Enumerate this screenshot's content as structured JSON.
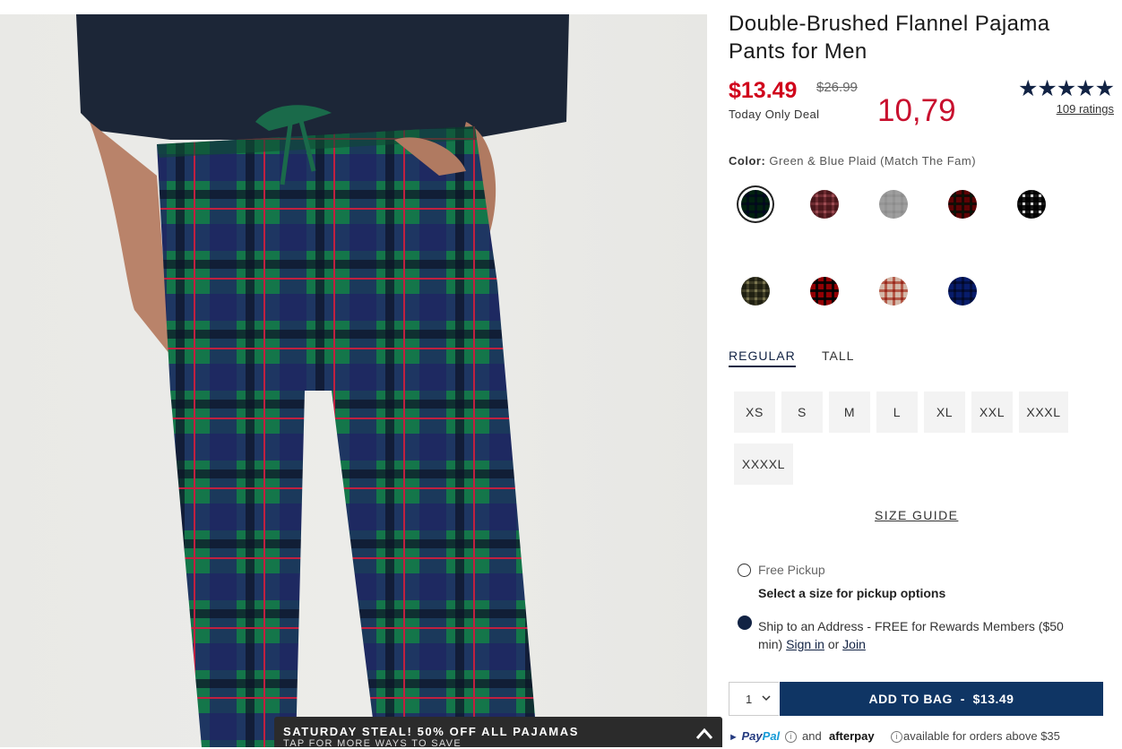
{
  "promo": {
    "title": "SATURDAY STEAL! 50% OFF ALL PAJAMAS",
    "subtitle": "TAP FOR MORE WAYS TO SAVE"
  },
  "product": {
    "title": "Double-Brushed Flannel Pajama Pants for Men",
    "price_now": "$13.49",
    "price_was": "$26.99",
    "deal_label": "Today Only Deal",
    "alt_price": "10,79",
    "stars": "★★★★★",
    "rating_count": 5,
    "ratings_label": "109 ratings",
    "color_label": "Color:",
    "color_value": "Green & Blue Plaid (Match The Fam)"
  },
  "swatches": [
    {
      "name": "green-blue-plaid",
      "colors": [
        "#0c5a40",
        "#1d2a5c"
      ],
      "selected": true
    },
    {
      "name": "mauve-plaid",
      "colors": [
        "#8a4f55",
        "#c98c92"
      ],
      "selected": false
    },
    {
      "name": "heather-gray",
      "colors": [
        "#c9c9c9",
        "#bdbdbd"
      ],
      "selected": false
    },
    {
      "name": "red-tartan",
      "colors": [
        "#9a1c1f",
        "#2b4a2a"
      ],
      "selected": false
    },
    {
      "name": "black-white-buffalo",
      "colors": [
        "#1a1a1a",
        "#e8e8e8"
      ],
      "selected": false
    },
    {
      "name": "olive-plaid",
      "colors": [
        "#5b5a44",
        "#b0ad8e"
      ],
      "selected": false
    },
    {
      "name": "red-black-buffalo",
      "colors": [
        "#c1121f",
        "#1a1a1a"
      ],
      "selected": false
    },
    {
      "name": "cream-red-plaid",
      "colors": [
        "#e8d8cf",
        "#c66a5a"
      ],
      "selected": false
    },
    {
      "name": "blue-buffalo",
      "colors": [
        "#2c55a5",
        "#1a2f63"
      ],
      "selected": false
    }
  ],
  "fit_tabs": [
    {
      "label": "REGULAR",
      "active": true
    },
    {
      "label": "TALL",
      "active": false
    }
  ],
  "sizes": [
    "XS",
    "S",
    "M",
    "L",
    "XL",
    "XXL",
    "XXXL",
    "XXXXL"
  ],
  "size_guide": "SIZE GUIDE",
  "fulfillment": {
    "pickup_label": "Free Pickup",
    "pickup_note": "Select a size for pickup options",
    "ship_text": "Ship to an Address - FREE for Rewards Members ($50",
    "ship_text2": "min)",
    "sign_in": "Sign in",
    "or": "or",
    "join": "Join"
  },
  "cart": {
    "quantity": "1",
    "add_label": "ADD TO BAG  -  $13.49"
  },
  "payment": {
    "paypal_a": "Pay",
    "paypal_b": "Pal",
    "and": "and",
    "afterpay": "afterpay",
    "note": "available for orders above $35"
  },
  "colors": {
    "sale_red": "#d0021b",
    "navy": "#0f3564",
    "star_navy": "#122344"
  }
}
